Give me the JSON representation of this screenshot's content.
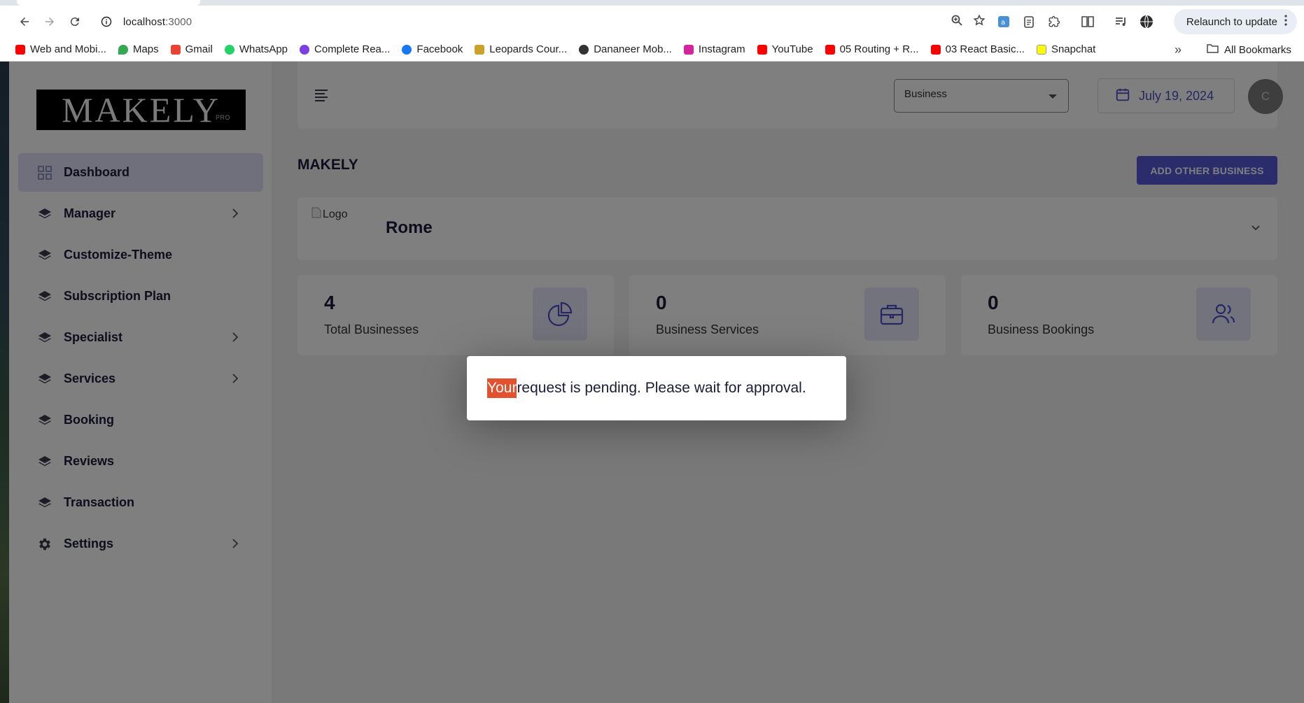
{
  "browser": {
    "url_host": "localhost",
    "url_port": ":3000",
    "relaunch_label": "Relaunch to update",
    "bookmarks": [
      {
        "label": "Web and Mobi...",
        "color": "#ff0000"
      },
      {
        "label": "Maps",
        "color": "#34a853"
      },
      {
        "label": "Gmail",
        "color": "#ea4335"
      },
      {
        "label": "WhatsApp",
        "color": "#25d366"
      },
      {
        "label": "Complete Rea...",
        "color": "#7b3fe4"
      },
      {
        "label": "Facebook",
        "color": "#1877f2"
      },
      {
        "label": "Leopards Cour...",
        "color": "#c9a227"
      },
      {
        "label": "Dananeer Mob...",
        "color": "#333333"
      },
      {
        "label": "Instagram",
        "color": "#d6249f"
      },
      {
        "label": "YouTube",
        "color": "#ff0000"
      },
      {
        "label": "05 Routing + R...",
        "color": "#ff0000"
      },
      {
        "label": "03 React Basic...",
        "color": "#ff0000"
      },
      {
        "label": "Snapchat",
        "color": "#fffc00"
      }
    ],
    "all_bookmarks_label": "All Bookmarks",
    "more_label": "»"
  },
  "sidebar": {
    "logo_text": "MAKELY",
    "logo_sub": "PRO",
    "items": [
      {
        "label": "Dashboard",
        "icon": "grid-icon",
        "chevron": false,
        "active": true
      },
      {
        "label": "Manager",
        "icon": "layers-icon",
        "chevron": true,
        "active": false
      },
      {
        "label": "Customize-Theme",
        "icon": "layers-icon",
        "chevron": false,
        "active": false
      },
      {
        "label": "Subscription Plan",
        "icon": "layers-icon",
        "chevron": false,
        "active": false
      },
      {
        "label": "Specialist",
        "icon": "layers-icon",
        "chevron": true,
        "active": false
      },
      {
        "label": "Services",
        "icon": "layers-icon",
        "chevron": true,
        "active": false
      },
      {
        "label": "Booking",
        "icon": "layers-icon",
        "chevron": false,
        "active": false
      },
      {
        "label": "Reviews",
        "icon": "layers-icon",
        "chevron": false,
        "active": false
      },
      {
        "label": "Transaction",
        "icon": "layers-icon",
        "chevron": false,
        "active": false
      },
      {
        "label": "Settings",
        "icon": "gear-icon",
        "chevron": true,
        "active": false
      }
    ]
  },
  "header": {
    "business_select_value": "Business",
    "date": "July 19, 2024",
    "avatar_initial": "C"
  },
  "main": {
    "title": "MAKELY",
    "add_button": "ADD OTHER BUSINESS",
    "business": {
      "logo_alt": "Logo",
      "name": "Rome"
    },
    "stats": [
      {
        "value": "4",
        "label": "Total Businesses",
        "icon": "pie-chart-icon"
      },
      {
        "value": "0",
        "label": "Business Services",
        "icon": "briefcase-icon"
      },
      {
        "value": "0",
        "label": "Business Bookings",
        "icon": "users-icon"
      }
    ]
  },
  "toast": {
    "highlight": "Your",
    "message": " request is pending. Please wait for approval."
  },
  "colors": {
    "accent": "#5458d8",
    "active_bg": "#e1e1f8",
    "highlight": "#e2522e"
  }
}
